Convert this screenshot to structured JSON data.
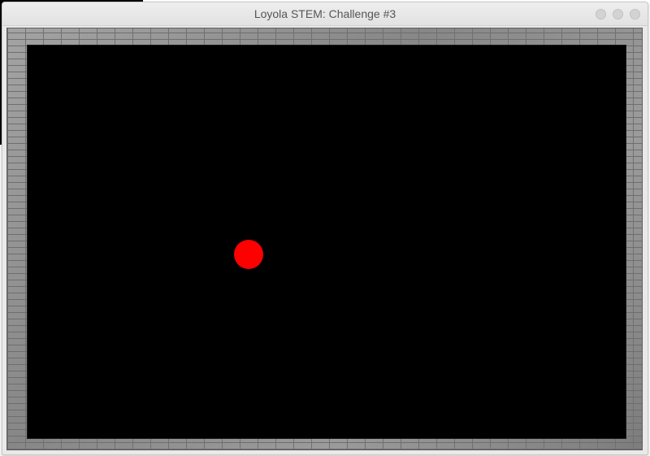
{
  "window": {
    "title": "Loyola STEM: Challenge #3"
  },
  "game": {
    "background_color": "#000000",
    "ball": {
      "color": "#ff0000",
      "shape": "circle"
    },
    "border": "grey-brick-wall"
  },
  "icons": {
    "minimize": "window-minimize-icon",
    "maximize": "window-maximize-icon",
    "close": "window-close-icon"
  }
}
